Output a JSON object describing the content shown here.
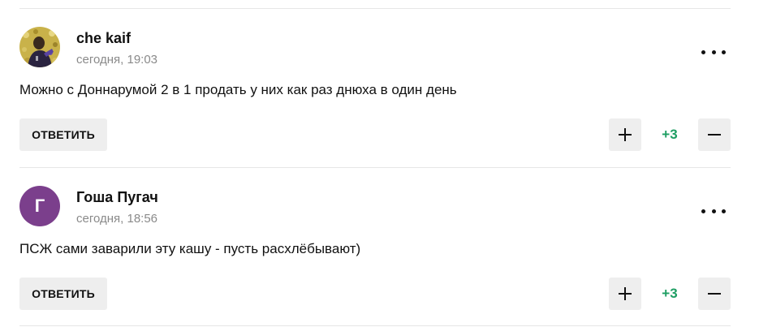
{
  "comments": [
    {
      "author": "che kaif",
      "time": "сегодня, 19:03",
      "avatar_letter": "",
      "text": "Можно с Доннарумой 2 в 1 продать у них как раз днюха в один день",
      "reply_label": "ОТВЕТИТЬ",
      "score": "+3",
      "score_color": "#1e9e63"
    },
    {
      "author": "Гоша Пугач",
      "time": "сегодня, 18:56",
      "avatar_letter": "Г",
      "avatar_color": "#7b3f8c",
      "text": "ПСЖ сами заварили эту кашу - пусть расхлёбывают)",
      "reply_label": "ОТВЕТИТЬ",
      "score": "+3",
      "score_color": "#1e9e63"
    }
  ],
  "icons": {
    "more": "more-dots-icon",
    "upvote": "plus-icon",
    "downvote": "minus-icon"
  }
}
